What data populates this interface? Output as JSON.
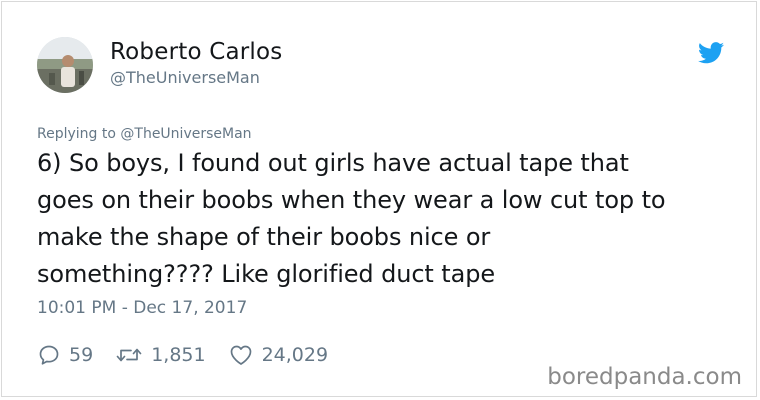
{
  "tweet": {
    "display_name": "Roberto Carlos",
    "handle": "@TheUniverseMan",
    "replying_prefix": "Replying to",
    "replying_to": "@TheUniverseMan",
    "lines": [
      "6) So boys, I found out girls have actual tape that",
      "goes on their boobs when they wear a low cut top to",
      "make the shape of their boobs nice or",
      "something???? Like glorified duct tape"
    ],
    "timestamp": "10:01 PM - Dec 17, 2017",
    "stats": {
      "replies": "59",
      "retweets": "1,851",
      "likes": "24,029"
    }
  },
  "icons": {
    "brand": "twitter-bird-icon",
    "reply": "reply-icon",
    "retweet": "retweet-icon",
    "like": "heart-icon"
  },
  "colors": {
    "brand": "#1da1f2",
    "text": "#14171a",
    "muted": "#657786"
  },
  "watermark": "boredpanda.com"
}
